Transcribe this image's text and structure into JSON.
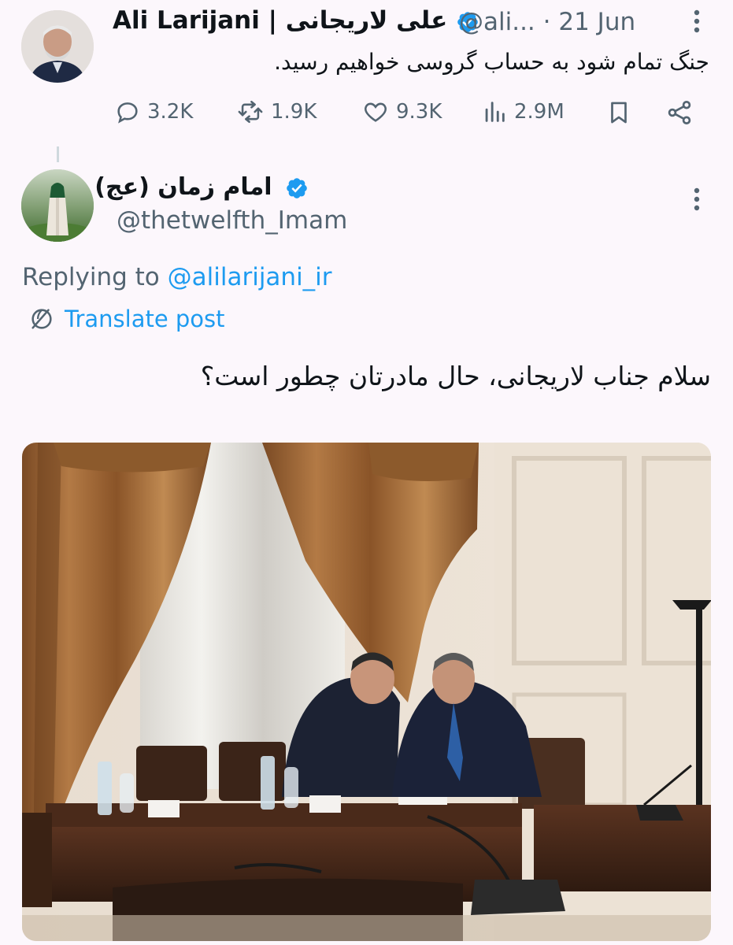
{
  "tweet1": {
    "name": "Ali Larijani | علی لاریجانی",
    "handle": "@ali...",
    "separator": "·",
    "date": "21 Jun",
    "text": "جنگ تمام شود به حساب گروسی خواهیم رسید.",
    "stats": {
      "replies": "3.2K",
      "reposts": "1.9K",
      "likes": "9.3K",
      "views": "2.9M"
    }
  },
  "tweet2": {
    "name": "امام زمان (عج)",
    "handle": "@thetwelfth_Imam",
    "replying_prefix": "Replying to ",
    "replying_to": "@alilarijani_ir",
    "translate_label": "Translate post",
    "text": "سلام جناب لاریجانی، حال مادرتان چطور است؟"
  },
  "colors": {
    "background": "#fcf7fc",
    "text": "#0f1419",
    "secondary": "#536471",
    "link": "#1d9bf0",
    "verified": "#1d9bf0"
  },
  "icons": {
    "reply": "reply-icon",
    "repost": "repost-icon",
    "like": "heart-icon",
    "views": "views-icon",
    "bookmark": "bookmark-icon",
    "share": "share-icon",
    "more": "more-vertical-icon",
    "verified": "verified-badge-icon",
    "translate": "translate-icon"
  }
}
